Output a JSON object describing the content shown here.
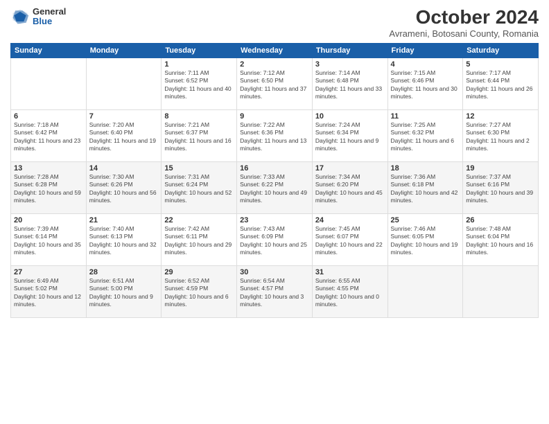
{
  "header": {
    "logo_general": "General",
    "logo_blue": "Blue",
    "month_title": "October 2024",
    "subtitle": "Avrameni, Botosani County, Romania"
  },
  "weekdays": [
    "Sunday",
    "Monday",
    "Tuesday",
    "Wednesday",
    "Thursday",
    "Friday",
    "Saturday"
  ],
  "weeks": [
    [
      {
        "day": "",
        "info": ""
      },
      {
        "day": "",
        "info": ""
      },
      {
        "day": "1",
        "info": "Sunrise: 7:11 AM\nSunset: 6:52 PM\nDaylight: 11 hours and 40 minutes."
      },
      {
        "day": "2",
        "info": "Sunrise: 7:12 AM\nSunset: 6:50 PM\nDaylight: 11 hours and 37 minutes."
      },
      {
        "day": "3",
        "info": "Sunrise: 7:14 AM\nSunset: 6:48 PM\nDaylight: 11 hours and 33 minutes."
      },
      {
        "day": "4",
        "info": "Sunrise: 7:15 AM\nSunset: 6:46 PM\nDaylight: 11 hours and 30 minutes."
      },
      {
        "day": "5",
        "info": "Sunrise: 7:17 AM\nSunset: 6:44 PM\nDaylight: 11 hours and 26 minutes."
      }
    ],
    [
      {
        "day": "6",
        "info": "Sunrise: 7:18 AM\nSunset: 6:42 PM\nDaylight: 11 hours and 23 minutes."
      },
      {
        "day": "7",
        "info": "Sunrise: 7:20 AM\nSunset: 6:40 PM\nDaylight: 11 hours and 19 minutes."
      },
      {
        "day": "8",
        "info": "Sunrise: 7:21 AM\nSunset: 6:37 PM\nDaylight: 11 hours and 16 minutes."
      },
      {
        "day": "9",
        "info": "Sunrise: 7:22 AM\nSunset: 6:36 PM\nDaylight: 11 hours and 13 minutes."
      },
      {
        "day": "10",
        "info": "Sunrise: 7:24 AM\nSunset: 6:34 PM\nDaylight: 11 hours and 9 minutes."
      },
      {
        "day": "11",
        "info": "Sunrise: 7:25 AM\nSunset: 6:32 PM\nDaylight: 11 hours and 6 minutes."
      },
      {
        "day": "12",
        "info": "Sunrise: 7:27 AM\nSunset: 6:30 PM\nDaylight: 11 hours and 2 minutes."
      }
    ],
    [
      {
        "day": "13",
        "info": "Sunrise: 7:28 AM\nSunset: 6:28 PM\nDaylight: 10 hours and 59 minutes."
      },
      {
        "day": "14",
        "info": "Sunrise: 7:30 AM\nSunset: 6:26 PM\nDaylight: 10 hours and 56 minutes."
      },
      {
        "day": "15",
        "info": "Sunrise: 7:31 AM\nSunset: 6:24 PM\nDaylight: 10 hours and 52 minutes."
      },
      {
        "day": "16",
        "info": "Sunrise: 7:33 AM\nSunset: 6:22 PM\nDaylight: 10 hours and 49 minutes."
      },
      {
        "day": "17",
        "info": "Sunrise: 7:34 AM\nSunset: 6:20 PM\nDaylight: 10 hours and 45 minutes."
      },
      {
        "day": "18",
        "info": "Sunrise: 7:36 AM\nSunset: 6:18 PM\nDaylight: 10 hours and 42 minutes."
      },
      {
        "day": "19",
        "info": "Sunrise: 7:37 AM\nSunset: 6:16 PM\nDaylight: 10 hours and 39 minutes."
      }
    ],
    [
      {
        "day": "20",
        "info": "Sunrise: 7:39 AM\nSunset: 6:14 PM\nDaylight: 10 hours and 35 minutes."
      },
      {
        "day": "21",
        "info": "Sunrise: 7:40 AM\nSunset: 6:13 PM\nDaylight: 10 hours and 32 minutes."
      },
      {
        "day": "22",
        "info": "Sunrise: 7:42 AM\nSunset: 6:11 PM\nDaylight: 10 hours and 29 minutes."
      },
      {
        "day": "23",
        "info": "Sunrise: 7:43 AM\nSunset: 6:09 PM\nDaylight: 10 hours and 25 minutes."
      },
      {
        "day": "24",
        "info": "Sunrise: 7:45 AM\nSunset: 6:07 PM\nDaylight: 10 hours and 22 minutes."
      },
      {
        "day": "25",
        "info": "Sunrise: 7:46 AM\nSunset: 6:05 PM\nDaylight: 10 hours and 19 minutes."
      },
      {
        "day": "26",
        "info": "Sunrise: 7:48 AM\nSunset: 6:04 PM\nDaylight: 10 hours and 16 minutes."
      }
    ],
    [
      {
        "day": "27",
        "info": "Sunrise: 6:49 AM\nSunset: 5:02 PM\nDaylight: 10 hours and 12 minutes."
      },
      {
        "day": "28",
        "info": "Sunrise: 6:51 AM\nSunset: 5:00 PM\nDaylight: 10 hours and 9 minutes."
      },
      {
        "day": "29",
        "info": "Sunrise: 6:52 AM\nSunset: 4:59 PM\nDaylight: 10 hours and 6 minutes."
      },
      {
        "day": "30",
        "info": "Sunrise: 6:54 AM\nSunset: 4:57 PM\nDaylight: 10 hours and 3 minutes."
      },
      {
        "day": "31",
        "info": "Sunrise: 6:55 AM\nSunset: 4:55 PM\nDaylight: 10 hours and 0 minutes."
      },
      {
        "day": "",
        "info": ""
      },
      {
        "day": "",
        "info": ""
      }
    ]
  ]
}
